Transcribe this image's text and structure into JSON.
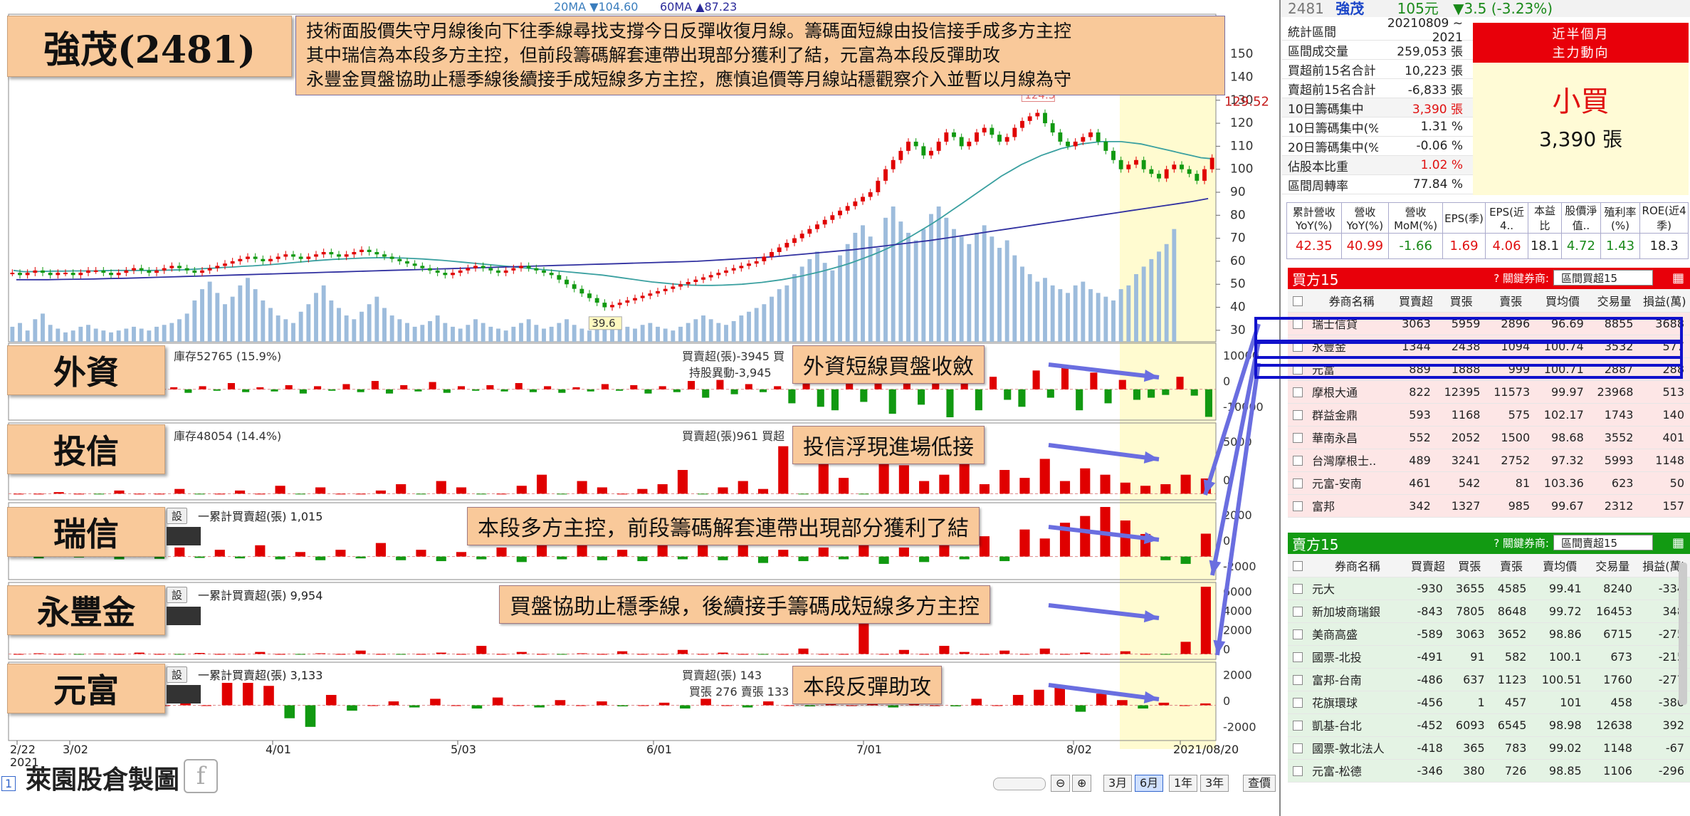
{
  "title_box": "強茂(2481)",
  "commentary": [
    "技術面股價失守月線後向下往季線尋找支撐今日反彈收復月線。籌碼面短線由投信接手成多方主控",
    "其中瑞信為本段多方主控，但前段籌碼解套連帶出現部分獲利了結，元富為本段反彈助攻",
    "永豐金買盤協助止穩季線後續接手成短線多方主控，應慎追價等月線站穩觀察介入並暫以月線為守"
  ],
  "legend_ma": {
    "ma20": "20MA ▼104.60",
    "ma60": "60MA ▲87.23"
  },
  "price_labels": {
    "high": "124.5",
    "low": "39.6",
    "last": "129.52"
  },
  "side_labels": [
    "外資",
    "投信",
    "瑞信",
    "永豐金",
    "元富"
  ],
  "annotations": [
    "外資短線買盤收斂",
    "投信浮現進場低接",
    "本段多方主控，前段籌碼解套連帶出現部分獲利了結",
    "買盤協助止穩季線，後續接手籌碼成短線多方主控",
    "本段反彈助攻"
  ],
  "sub_legends": {
    "foreign_left": "庫存52765 (15.9%)",
    "foreign_right": "買賣超(張)-3945 買",
    "foreign_right2": "持股異動-3,945",
    "trust_left": "庫存48054 (14.4%)",
    "trust_right": "買賣超(張)961 買超",
    "cs_left": "一累計買賣超(張) 1,015",
    "sinopac_left": "一累計買賣超(張) 9,954",
    "masterlink_left": "一累計買賣超(張) 3,133",
    "masterlink_right": "買賣超(張) 143",
    "masterlink_right2": "買張 276 賣張 133",
    "btn": "設"
  },
  "y_axis": {
    "price": [
      "150",
      "140",
      "130",
      "120",
      "110",
      "100",
      "90",
      "80",
      "70",
      "60",
      "50",
      "40",
      "30"
    ],
    "foreign": [
      "10000",
      "0",
      "-10000"
    ],
    "trust": [
      "5000",
      "0"
    ],
    "cs": [
      "2000",
      "0",
      "-2000"
    ],
    "sinopac": [
      "6000",
      "4000",
      "2000",
      "0"
    ],
    "masterlink": [
      "2000",
      "0",
      "-2000"
    ]
  },
  "x_axis": [
    "2/22\n2021",
    "3/02",
    "4/01",
    "5/03",
    "6/01",
    "7/01",
    "8/02",
    "2021/08/20"
  ],
  "watermark": "萊園股倉製圖",
  "toolbar": {
    "b3m": "3月",
    "b6m": "6月",
    "b1y": "1年",
    "b3y": "3年",
    "sel": "查價",
    "page": "1"
  },
  "stock": {
    "code": "2481",
    "name": "強茂",
    "price": "105元",
    "change": "▼3.5 (-3.23%)"
  },
  "stats": [
    {
      "k": "統計區間",
      "v": "20210809 ~ 2021"
    },
    {
      "k": "區間成交量",
      "v": "259,053 張"
    },
    {
      "k": "買超前15名合計",
      "v": "10,223 張"
    },
    {
      "k": "賣超前15名合計",
      "v": "-6,833 張"
    },
    {
      "k": "10日籌碼集中",
      "v": "3,390 張"
    },
    {
      "k": "10日籌碼集中(%)",
      "v": "1.31 %"
    },
    {
      "k": "20日籌碼集中(%)",
      "v": "-0.06 %"
    },
    {
      "k": "佔股本比重",
      "v": "1.02 %"
    },
    {
      "k": "區間周轉率",
      "v": "77.84 %"
    }
  ],
  "trend": {
    "head1": "近半個月",
    "head2": "主力動向",
    "main": "小買",
    "sub": "3,390 張"
  },
  "fin": {
    "headers": [
      "累計營收YoY(%)",
      "營收YoY(%)",
      "營收MoM(%)",
      "EPS(季)",
      "EPS(近4..",
      "本益比",
      "股價淨值..",
      "殖利率(%)",
      "ROE(近4季)"
    ],
    "values": [
      "42.35",
      "40.99",
      "-1.66",
      "1.69",
      "4.06",
      "18.1",
      "4.72",
      "1.43",
      "18.3"
    ]
  },
  "buy_panel": {
    "title": "買方15",
    "filter_label": "? 關鍵券商:",
    "filter": "區間買超15",
    "headers": [
      "券商名稱",
      "買賣超",
      "買張",
      "賣張",
      "買均價",
      "交易量",
      "損益(萬)"
    ],
    "rows": [
      [
        "瑞士信貸",
        "3063",
        "5959",
        "2896",
        "96.69",
        "8855",
        "3688"
      ],
      [
        "永豐金",
        "1344",
        "2438",
        "1094",
        "100.74",
        "3532",
        "577"
      ],
      [
        "元富",
        "889",
        "1888",
        "999",
        "100.71",
        "2887",
        "288"
      ],
      [
        "摩根大通",
        "822",
        "12395",
        "11573",
        "99.97",
        "23968",
        "513"
      ],
      [
        "群益金鼎",
        "593",
        "1168",
        "575",
        "102.17",
        "1743",
        "140"
      ],
      [
        "華南永昌",
        "552",
        "2052",
        "1500",
        "98.68",
        "3552",
        "401"
      ],
      [
        "台灣摩根士..",
        "489",
        "3241",
        "2752",
        "97.32",
        "5993",
        "1148"
      ],
      [
        "元富-安南",
        "461",
        "542",
        "81",
        "103.36",
        "623",
        "50"
      ],
      [
        "富邦",
        "342",
        "1327",
        "985",
        "99.67",
        "2312",
        "157"
      ]
    ]
  },
  "sell_panel": {
    "title": "賣方15",
    "filter_label": "? 關鍵券商:",
    "filter": "區間賣超15",
    "headers": [
      "券商名稱",
      "買賣超",
      "買張",
      "賣張",
      "賣均價",
      "交易量",
      "損益(萬)"
    ],
    "rows": [
      [
        "元大",
        "-930",
        "3655",
        "4585",
        "99.41",
        "8240",
        "-334"
      ],
      [
        "新加坡商瑞銀",
        "-843",
        "7805",
        "8648",
        "99.72",
        "16453",
        "348"
      ],
      [
        "美商高盛",
        "-589",
        "3063",
        "3652",
        "98.86",
        "6715",
        "-275"
      ],
      [
        "國票-北投",
        "-491",
        "91",
        "582",
        "100.1",
        "673",
        "-215"
      ],
      [
        "富邦-台南",
        "-486",
        "637",
        "1123",
        "100.51",
        "1760",
        "-277"
      ],
      [
        "花旗環球",
        "-456",
        "1",
        "457",
        "101",
        "458",
        "-386"
      ],
      [
        "凱基-台北",
        "-452",
        "6093",
        "6545",
        "98.98",
        "12638",
        "392"
      ],
      [
        "國票-敦北法人",
        "-418",
        "365",
        "783",
        "99.02",
        "1148",
        "-67"
      ],
      [
        "元富-松德",
        "-346",
        "380",
        "726",
        "98.85",
        "1106",
        "-296"
      ]
    ]
  },
  "chart_data": {
    "type": "candlestick",
    "x_range": [
      "2021-02-22",
      "2021-08-20"
    ],
    "close": [
      55,
      54,
      55,
      56,
      55,
      54,
      55,
      55,
      54,
      55,
      56,
      56,
      55,
      54,
      55,
      56,
      57,
      56,
      55,
      56,
      57,
      58,
      57,
      56,
      55,
      56,
      57,
      58,
      59,
      60,
      61,
      62,
      61,
      60,
      61,
      62,
      63,
      62,
      61,
      62,
      63,
      64,
      63,
      62,
      63,
      64,
      65,
      64,
      63,
      62,
      61,
      60,
      59,
      58,
      57,
      56,
      55,
      54,
      55,
      56,
      57,
      58,
      57,
      56,
      55,
      56,
      57,
      58,
      57,
      56,
      55,
      54,
      52,
      50,
      48,
      46,
      44,
      42,
      40,
      41,
      42,
      43,
      44,
      45,
      46,
      47,
      48,
      49,
      50,
      51,
      52,
      53,
      54,
      55,
      56,
      57,
      58,
      59,
      60,
      62,
      64,
      66,
      68,
      70,
      72,
      74,
      76,
      78,
      80,
      82,
      84,
      86,
      88,
      90,
      95,
      100,
      104,
      108,
      112,
      110,
      106,
      108,
      112,
      116,
      114,
      110,
      112,
      116,
      118,
      115,
      112,
      114,
      118,
      121,
      123,
      124.5,
      120,
      116,
      112,
      110,
      112,
      114,
      116,
      112,
      108,
      104,
      100,
      102,
      104,
      100,
      98,
      96,
      100,
      102,
      100,
      98,
      95,
      100,
      105
    ],
    "volume": [
      8,
      10,
      6,
      12,
      15,
      9,
      7,
      5,
      6,
      8,
      9,
      7,
      6,
      5,
      6,
      7,
      8,
      7,
      6,
      8,
      9,
      10,
      12,
      15,
      22,
      28,
      32,
      26,
      20,
      24,
      30,
      34,
      28,
      22,
      18,
      14,
      12,
      10,
      16,
      20,
      26,
      30,
      22,
      18,
      14,
      12,
      16,
      20,
      24,
      18,
      14,
      12,
      10,
      8,
      9,
      11,
      14,
      10,
      8,
      7,
      9,
      12,
      10,
      8,
      7,
      6,
      8,
      10,
      12,
      9,
      7,
      8,
      10,
      12,
      9,
      7,
      6,
      8,
      10,
      12,
      9,
      8,
      7,
      9,
      10,
      8,
      7,
      6,
      8,
      10,
      12,
      14,
      12,
      10,
      9,
      11,
      14,
      16,
      18,
      20,
      24,
      28,
      30,
      36,
      40,
      44,
      48,
      42,
      38,
      46,
      52,
      58,
      62,
      56,
      50,
      66,
      72,
      64,
      58,
      54,
      60,
      68,
      72,
      66,
      60,
      56,
      52,
      58,
      62,
      56,
      50,
      54,
      46,
      40,
      36,
      32,
      34,
      30,
      28,
      26,
      30,
      32,
      28,
      26,
      24,
      22,
      28,
      30,
      36,
      40,
      44,
      48,
      52,
      60
    ],
    "ma20": [
      56,
      55.5,
      55.5,
      55.6,
      55.7,
      55.7,
      55.8,
      55.8,
      55.8,
      55.9,
      56,
      56,
      56,
      56,
      56,
      56.1,
      56.2,
      56.3,
      56.5,
      56.8,
      57,
      57.3,
      57.5,
      57.8,
      58,
      58.3,
      58.6,
      59,
      59.4,
      59.8,
      60.2,
      60.5,
      60.8,
      61,
      61.2,
      61.4,
      61.5,
      61.6,
      61.5,
      61.4,
      61.2,
      61,
      60.7,
      60.4,
      60,
      59.6,
      59.2,
      58.8,
      58.4,
      58,
      57.6,
      57.2,
      56.8,
      56.4,
      56,
      55.6,
      55.2,
      54.8,
      54.4,
      54,
      53.4,
      52.8,
      52.2,
      51.6,
      51,
      50.6,
      50.2,
      49.8,
      49.6,
      49.5,
      49.5,
      49.6,
      49.8,
      50,
      50.4,
      50.8,
      51.4,
      52,
      52.8,
      53.6,
      54.6,
      55.6,
      56.8,
      58,
      59.4,
      61,
      62.6,
      64.4,
      66.4,
      68.6,
      71,
      73.6,
      76.2,
      79,
      82,
      85,
      88,
      91,
      94,
      97,
      99.5,
      102,
      104,
      106,
      107.5,
      109,
      110,
      111,
      111.5,
      112,
      112,
      112,
      111.5,
      111,
      110,
      109,
      108,
      107,
      106,
      105,
      104.6
    ],
    "ma60": [
      52,
      52,
      52,
      52.1,
      52.2,
      52.3,
      52.5,
      52.6,
      52.8,
      53,
      53.2,
      53.4,
      53.6,
      53.8,
      54,
      54.2,
      54.4,
      54.6,
      54.8,
      55,
      55.2,
      55.4,
      55.6,
      55.8,
      56,
      56.2,
      56.4,
      56.6,
      56.8,
      57,
      57.2,
      57.4,
      57.6,
      57.8,
      58,
      58.2,
      58.4,
      58.6,
      58.8,
      59,
      59.2,
      59.4,
      59.6,
      59.8,
      60,
      60.4,
      60.8,
      61.2,
      61.6,
      62,
      62.6,
      63.2,
      63.8,
      64.4,
      65,
      65.8,
      66.6,
      67.4,
      68.2,
      69,
      70,
      71,
      72,
      73,
      74,
      75,
      76,
      77,
      78,
      79,
      80,
      81,
      82,
      83,
      84,
      85,
      86,
      87.23
    ],
    "foreign": [
      -200,
      300,
      -400,
      500,
      -300,
      200,
      -100,
      150,
      -200,
      400,
      -300,
      200,
      -500,
      300,
      -200,
      600,
      -400,
      200,
      -300,
      400,
      -600,
      300,
      -200,
      500,
      -400,
      800,
      -600,
      400,
      -300,
      700,
      -500,
      300,
      -200,
      400,
      -300,
      600,
      -400,
      300,
      -500,
      200,
      -300,
      500,
      -200,
      400,
      -600,
      300,
      -400,
      800,
      -1200,
      900,
      -700,
      500,
      -400,
      300,
      -2000,
      1500,
      -2500,
      -3000,
      2000,
      -1800,
      2500,
      -3500,
      1500,
      -2200,
      1800,
      -4000,
      2500,
      -3000,
      1200,
      -1500,
      -2500,
      1800,
      -1200,
      2200,
      -3000,
      1600,
      -2000,
      900,
      -1500,
      -1200,
      -800,
      1200,
      -900,
      -3945
    ],
    "trust": [
      0,
      0,
      100,
      0,
      -100,
      200,
      0,
      0,
      300,
      -100,
      0,
      200,
      0,
      500,
      -300,
      400,
      0,
      0,
      200,
      600,
      -200,
      800,
      400,
      -300,
      0,
      500,
      1200,
      -400,
      800,
      400,
      0,
      300,
      600,
      1500,
      -200,
      400,
      800,
      300,
      3000,
      -500,
      4200,
      1000,
      -600,
      2500,
      1800,
      800,
      1200,
      2000,
      600,
      1500,
      1000,
      2200,
      800,
      1600,
      1200,
      700,
      500,
      600,
      1200,
      961
    ],
    "credit_suisse": [
      100,
      -200,
      300,
      -100,
      200,
      -300,
      150,
      -250,
      400,
      -150,
      300,
      -200,
      500,
      -300,
      200,
      -400,
      300,
      -200,
      600,
      -400,
      300,
      -500,
      200,
      -300,
      400,
      -600,
      500,
      -300,
      700,
      -400,
      300,
      -500,
      600,
      -300,
      800,
      -400,
      500,
      -700,
      300,
      -500,
      400,
      -300,
      600,
      -800,
      400,
      -600,
      500,
      -300,
      900,
      -500,
      1200,
      800,
      1500,
      1800,
      2200,
      1600,
      1000,
      -400,
      -800,
      1015
    ],
    "sinopac": [
      0,
      100,
      0,
      -100,
      50,
      0,
      200,
      0,
      -100,
      150,
      0,
      0,
      300,
      0,
      -200,
      100,
      0,
      500,
      0,
      -100,
      0,
      200,
      0,
      1200,
      0,
      300,
      0,
      -200,
      100,
      0,
      400,
      0,
      0,
      600,
      0,
      200,
      0,
      -300,
      0,
      800,
      0,
      0,
      4800,
      0,
      600,
      0,
      1200,
      300,
      0,
      500,
      0,
      800,
      0,
      200,
      0,
      400,
      0,
      -300,
      1800,
      9954
    ],
    "masterlink": [
      0,
      100,
      -200,
      0,
      300,
      0,
      -100,
      0,
      200,
      0,
      3000,
      2200,
      1500,
      -1200,
      -2000,
      800,
      -500,
      0,
      300,
      -200,
      500,
      0,
      -300,
      600,
      0,
      -200,
      400,
      0,
      300,
      -100,
      0,
      200,
      -300,
      500,
      0,
      -200,
      300,
      0,
      -100,
      200,
      0,
      400,
      -200,
      300,
      0,
      -100,
      500,
      0,
      800,
      1200,
      1500,
      -600,
      900,
      400,
      -300,
      200,
      0,
      143
    ]
  }
}
